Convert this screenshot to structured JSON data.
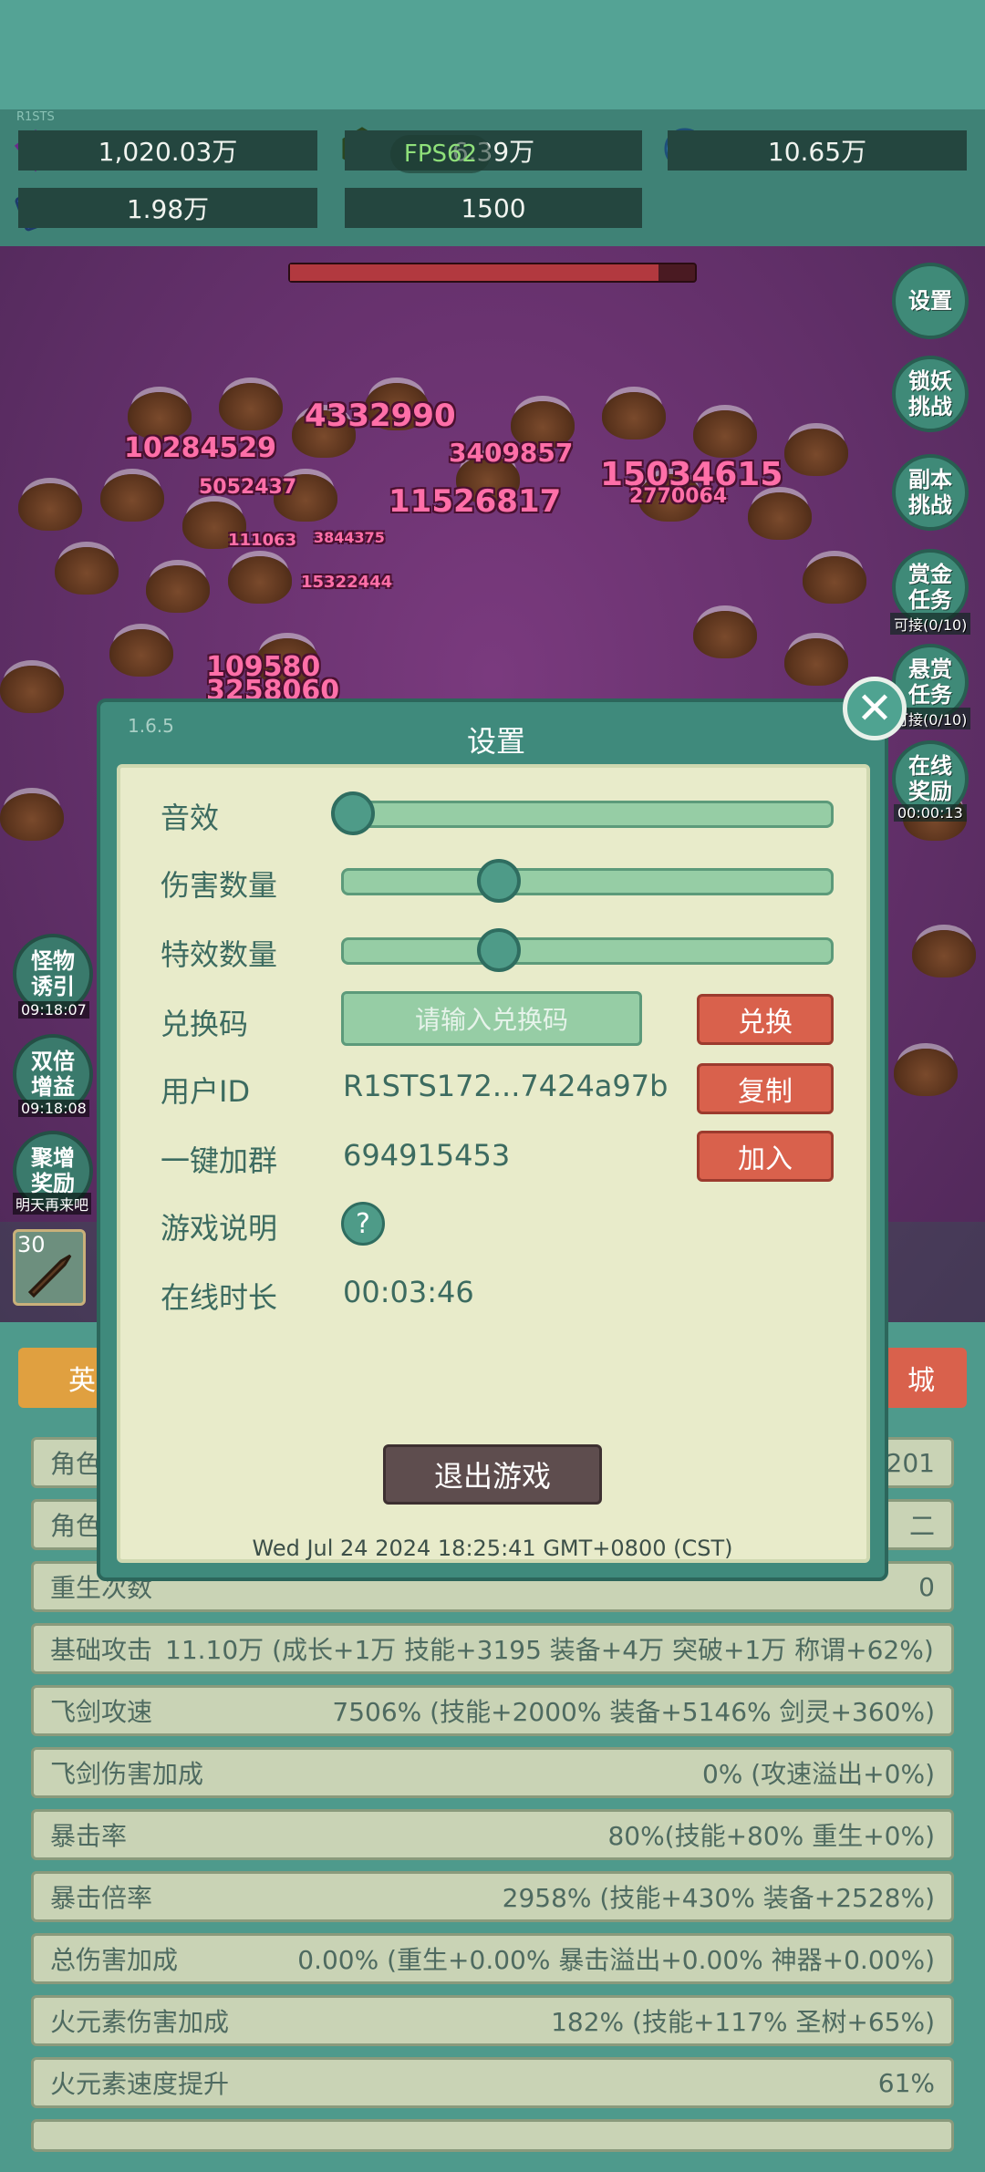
{
  "header": {
    "version_small": "R1STS",
    "fps": "FPS62",
    "resources": [
      {
        "icon": "purple-gem-icon",
        "value": "1,020.03万"
      },
      {
        "icon": "green-gem-icon",
        "value": "6.39万"
      },
      {
        "icon": "blue-orb-icon",
        "value": "10.65万"
      },
      {
        "icon": "book-icon",
        "value": "1.98万"
      },
      {
        "icon": "crystal-icon",
        "value": "1500"
      }
    ]
  },
  "battle": {
    "damage_numbers": [
      "10284529",
      "4332990",
      "3409857",
      "15034615",
      "5052437",
      "11526817",
      "2770064",
      "109580",
      "3258060",
      "111063",
      "15322444",
      "3844375"
    ]
  },
  "side_buttons": [
    {
      "label": "设置",
      "sub": ""
    },
    {
      "label": "锁妖挑战",
      "sub": ""
    },
    {
      "label": "副本挑战",
      "sub": ""
    },
    {
      "label": "赏金任务",
      "sub": "可接(0/10)"
    },
    {
      "label": "悬赏任务",
      "sub": "可接(0/10)"
    },
    {
      "label": "在线奖励",
      "sub": "00:00:13"
    }
  ],
  "left_buttons": [
    {
      "label": "怪物诱引",
      "sub": "09:18:07"
    },
    {
      "label": "双倍增益",
      "sub": "09:18:08"
    },
    {
      "label": "聚增奖励",
      "sub": "明天再来吧"
    }
  ],
  "settings": {
    "version": "1.6.5",
    "title": "设置",
    "sound_label": "音效",
    "sound_level": 0.0,
    "damage_count_label": "伤害数量",
    "damage_count_level": 0.33,
    "effects_count_label": "特效数量",
    "effects_count_level": 0.33,
    "redeem_label": "兑换码",
    "redeem_placeholder": "请输入兑换码",
    "redeem_button": "兑换",
    "user_id_label": "用户ID",
    "user_id_value": "R1STS172...7424a97b",
    "copy_button": "复制",
    "group_label": "一键加群",
    "group_value": "694915453",
    "join_button": "加入",
    "guide_label": "游戏说明",
    "guide_icon": "?",
    "online_label": "在线时长",
    "online_value": "00:03:46",
    "exit_button": "退出游戏",
    "datetime": "Wed Jul 24 2024 18:25:41 GMT+0800 (CST)"
  },
  "bottom": {
    "skill_level_1": "30",
    "tab_left": "英",
    "tab_right": "城",
    "rows": [
      {
        "label": "角色",
        "value": "201"
      },
      {
        "label": "角色",
        "value": "二"
      },
      {
        "label": "重生次数",
        "value": "0"
      },
      {
        "label": "基础攻击",
        "value": "11.10万 (成长+1万 技能+3195 装备+4万 突破+1万 称谓+62%)"
      },
      {
        "label": "飞剑攻速",
        "value": "7506% (技能+2000% 装备+5146% 剑灵+360%)"
      },
      {
        "label": "飞剑伤害加成",
        "value": "0% (攻速溢出+0%)"
      },
      {
        "label": "暴击率",
        "value": "80%(技能+80% 重生+0%)"
      },
      {
        "label": "暴击倍率",
        "value": "2958% (技能+430% 装备+2528%)"
      },
      {
        "label": "总伤害加成",
        "value": "0.00% (重生+0.00% 暴击溢出+0.00% 神器+0.00%)"
      },
      {
        "label": "火元素伤害加成",
        "value": "182% (技能+117% 圣树+65%)"
      },
      {
        "label": "火元素速度提升",
        "value": "61%"
      }
    ]
  }
}
